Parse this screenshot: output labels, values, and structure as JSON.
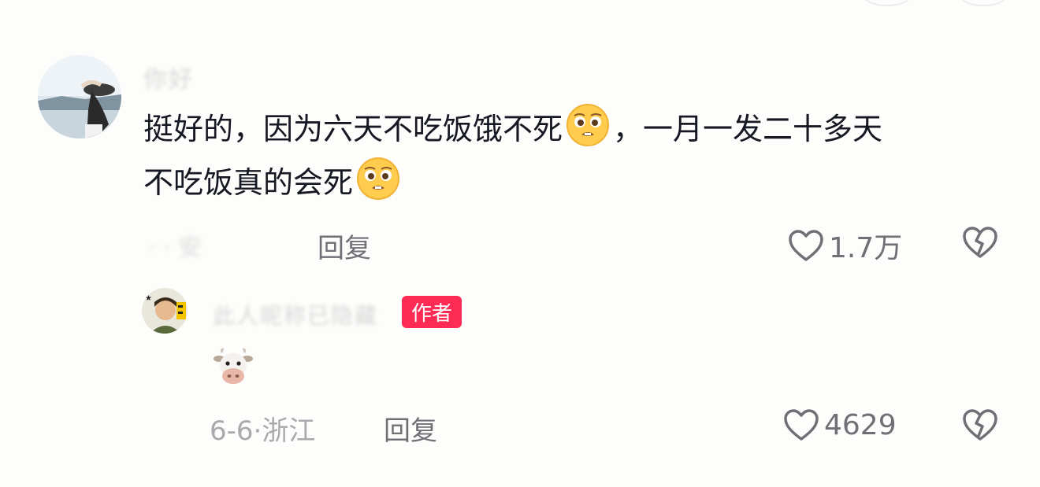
{
  "comment1": {
    "username": "你好",
    "text_part1": "挺好的，因为六天不吃饭饿不死",
    "text_part2": "，一月一发二十多天",
    "text_part3": "不吃饭真的会死",
    "meta_blurred": "· · 安",
    "reply_label": "回复",
    "like_count": "1.7万",
    "emoji": "pleading-face-icon"
  },
  "reply1": {
    "username": "此人昵称已隐藏",
    "author_badge": "作者",
    "emoji": "cow-face-icon",
    "date": "6-6",
    "location": "浙江",
    "separator": "·",
    "reply_label": "回复",
    "like_count": "4629"
  },
  "colors": {
    "accent": "#fe2c55",
    "text": "#161823",
    "secondary": "#6f6f76",
    "muted": "#a9a9ae"
  }
}
